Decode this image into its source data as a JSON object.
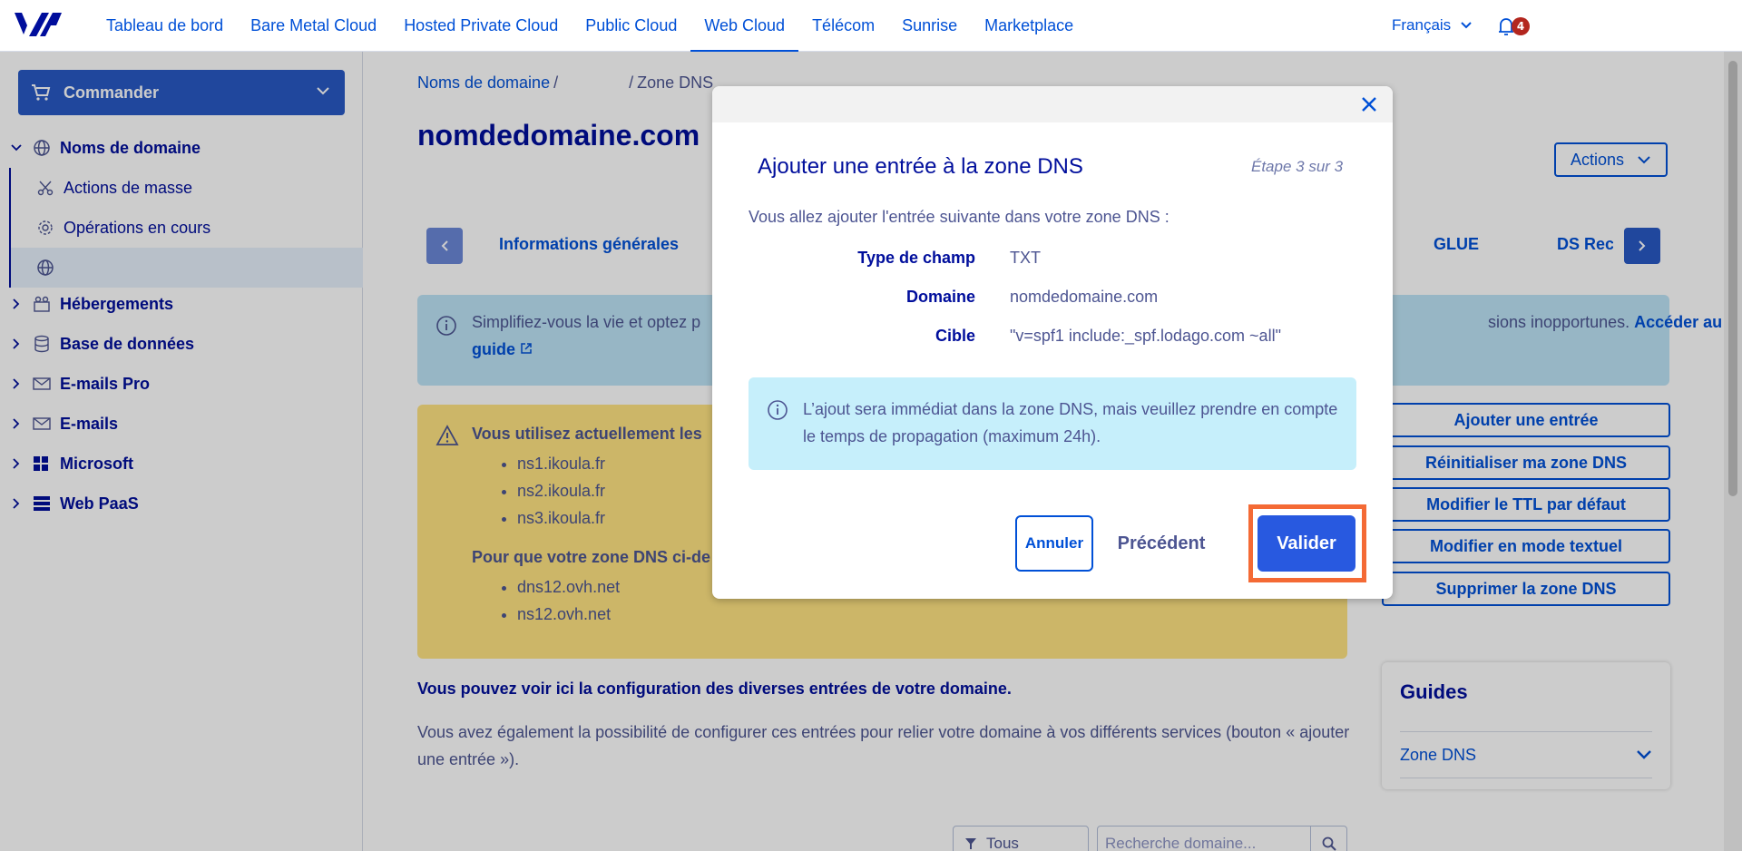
{
  "topbar": {
    "nav": [
      {
        "label": "Tableau de bord"
      },
      {
        "label": "Bare Metal Cloud"
      },
      {
        "label": "Hosted Private Cloud"
      },
      {
        "label": "Public Cloud"
      },
      {
        "label": "Web Cloud"
      },
      {
        "label": "Télécom"
      },
      {
        "label": "Sunrise"
      },
      {
        "label": "Marketplace"
      }
    ],
    "active_nav": "Web Cloud",
    "language": "Français",
    "notification_count": "4"
  },
  "sidebar": {
    "order_label": "Commander",
    "items": [
      {
        "label": "Noms de domaine",
        "icon": "globe-icon",
        "expanded": true
      },
      {
        "label": "Actions de masse",
        "icon": "scissors-icon"
      },
      {
        "label": "Opérations en cours",
        "icon": "gear-icon"
      },
      {
        "label": "",
        "icon": "globe-icon"
      },
      {
        "label": "Hébergements",
        "icon": "hosting-icon"
      },
      {
        "label": "Base de données",
        "icon": "database-icon"
      },
      {
        "label": "E-mails Pro",
        "icon": "mail-icon"
      },
      {
        "label": "E-mails",
        "icon": "mail-icon"
      },
      {
        "label": "Microsoft",
        "icon": "windows-icon"
      },
      {
        "label": "Web PaaS",
        "icon": "paas-icon"
      }
    ]
  },
  "main": {
    "breadcrumb": {
      "root": "Noms de domaine",
      "sep1": "/",
      "sep2": "/",
      "current": "Zone DNS"
    },
    "title": "nomdedomaine.com",
    "actions_label": "Actions",
    "tabs": [
      "Informations générales",
      "GLUE",
      "DS Reco"
    ],
    "info": {
      "text": "Simplifiez-vous la vie et optez p",
      "text_right": "sions inopportunes.",
      "link1": "Accéder au",
      "link2": "guide"
    },
    "warning": {
      "title": "Vous utilisez actuellement les",
      "servers": [
        "ns1.ikoula.fr",
        "ns2.ikoula.fr",
        "ns3.ikoula.fr"
      ],
      "subtitle": "Pour que votre zone DNS ci-de",
      "ovh_servers": [
        "dns12.ovh.net",
        "ns12.ovh.net"
      ]
    },
    "side_buttons": [
      "Ajouter une entrée",
      "Réinitialiser ma zone DNS",
      "Modifier le TTL par défaut",
      "Modifier en mode textuel",
      "Supprimer la zone DNS"
    ],
    "description_bold": "Vous pouvez voir ici la configuration des diverses entrées de votre domaine.",
    "description": "Vous avez également la possibilité de configurer ces entrées pour relier votre domaine à vos différents services (bouton « ajouter une entrée »).",
    "guides": {
      "title": "Guides",
      "item": "Zone DNS"
    },
    "filter_value": "Tous",
    "search_placeholder": "Recherche domaine..."
  },
  "modal": {
    "title": "Ajouter une entrée à la zone DNS",
    "step": "Étape 3 sur 3",
    "intro": "Vous allez ajouter l'entrée suivante dans votre zone DNS :",
    "fields": [
      {
        "label": "Type de champ",
        "value": "TXT"
      },
      {
        "label": "Domaine",
        "value": "nomdedomaine.com"
      },
      {
        "label": "Cible",
        "value": "\"v=spf1 include:_spf.lodago.com ~all\""
      }
    ],
    "notice": "L’ajout sera immédiat dans la zone DNS, mais veuillez prendre en compte le temps de propagation (maximum 24h).",
    "cancel_label": "Annuler",
    "previous_label": "Précédent",
    "validate_label": "Valider"
  },
  "colors": {
    "primary": "#0050d7",
    "dark": "#000e9c",
    "highlight": "#f46a35"
  }
}
